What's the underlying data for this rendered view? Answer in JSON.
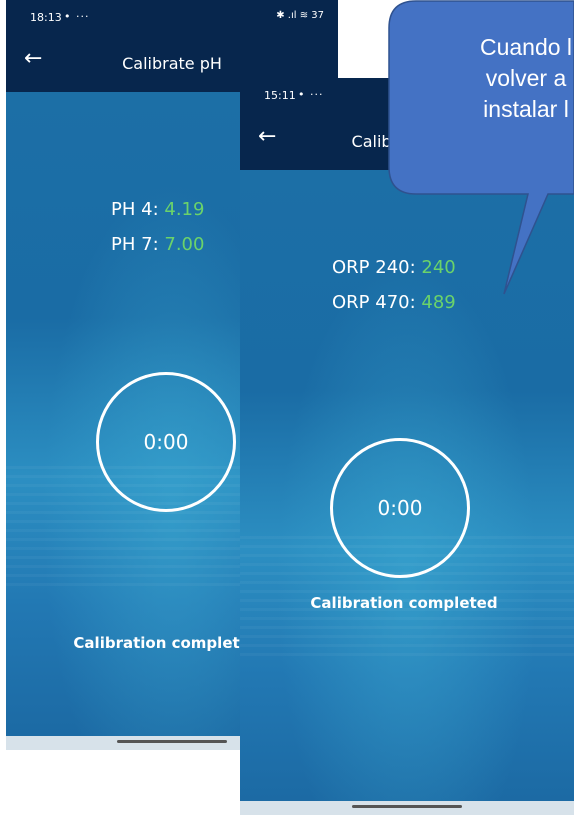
{
  "screen_ph": {
    "status": {
      "time": "18:13",
      "extra": "• ···",
      "icons": "✱ .ıl ≋ 37"
    },
    "title": "Calibrate pH",
    "back_icon": "arrow-left-icon",
    "readings": [
      {
        "label": "PH 4:",
        "value": "4.19"
      },
      {
        "label": "PH 7:",
        "value": "7.00"
      }
    ],
    "timer": "0:00",
    "status_text": "Calibration completed"
  },
  "screen_orp": {
    "status": {
      "time": "15:11",
      "extra": "• ···"
    },
    "title": "Calibrate ORP",
    "back_icon": "arrow-left-icon",
    "readings": [
      {
        "label": "ORP 240:",
        "value": "240"
      },
      {
        "label": "ORP 470:",
        "value": "489"
      }
    ],
    "timer": "0:00",
    "status_text": "Calibration completed"
  },
  "callout": {
    "line1": "Cuando l",
    "line2": "volver a",
    "line3": "instalar l"
  },
  "colors": {
    "appbar": "#07264d",
    "value_green": "#6bd36a",
    "callout": "#4472c4"
  }
}
